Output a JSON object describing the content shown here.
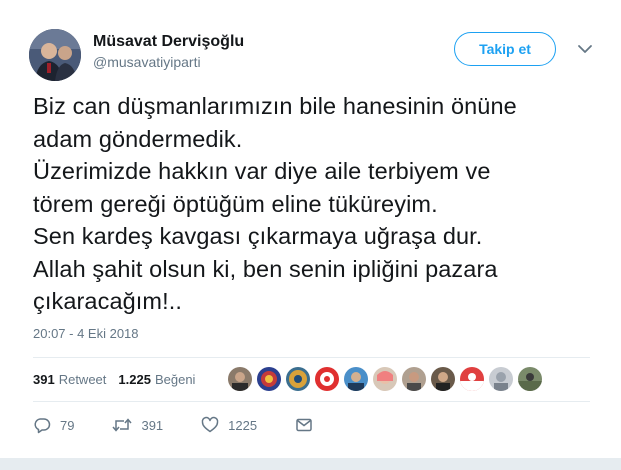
{
  "author": {
    "name": "Müsavat Dervişoğlu",
    "handle": "@musavatiyiparti"
  },
  "follow_button": "Takip et",
  "tweet": {
    "text": "Biz can düşmanlarımızın bile hanesinin önüne\nadam göndermedik.\nÜzerimizde hakkın var diye aile terbiyem ve\ntörem gereği öptüğüm eline tüküreyim.\nSen kardeş kavgası çıkarmaya uğraşa dur.\nAllah şahit olsun ki, ben senin ipliğini pazara\nçıkaracağım!..",
    "timestamp": "20:07 - 4 Eki 2018"
  },
  "stats": {
    "retweet_count": "391",
    "retweet_label": "Retweet",
    "like_count": "1.225",
    "like_label": "Beğeni"
  },
  "actions": {
    "reply_count": "79",
    "retweet_count": "391",
    "like_count": "1225"
  },
  "colors": {
    "accent": "#1da1f2",
    "secondary_text": "#657786",
    "divider": "#e6ecf0"
  }
}
